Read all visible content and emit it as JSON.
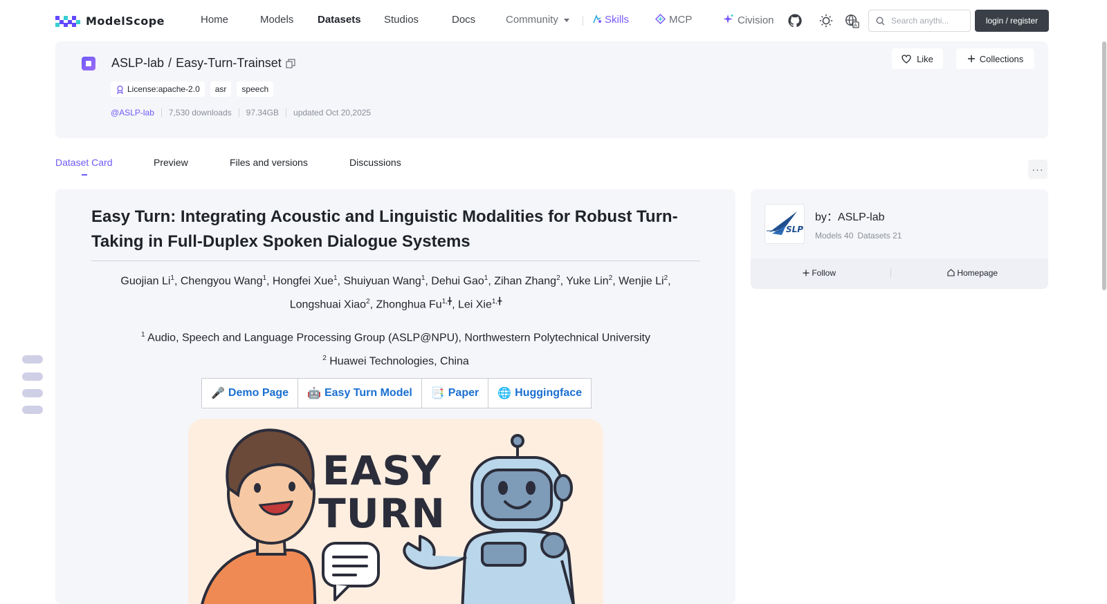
{
  "nav": {
    "logo_text": "ModelScope",
    "items": [
      "Home",
      "Models",
      "Datasets",
      "Studios",
      "Docs"
    ],
    "community": "Community",
    "skills": "Skills",
    "mcp": "MCP",
    "civision": "Civision",
    "search_placeholder": "Search anythi...",
    "login": "login / register"
  },
  "dataset": {
    "owner": "ASLP-lab",
    "sep": "/",
    "name": "Easy-Turn-Trainset",
    "tags": [
      "License:apache-2.0",
      "asr",
      "speech"
    ],
    "owner_handle": "@ASLP-lab",
    "downloads": "7,530 downloads",
    "size": "97.34GB",
    "updated": "updated Oct 20,2025",
    "like": "Like",
    "collections": "Collections"
  },
  "tabs": [
    "Dataset Card",
    "Preview",
    "Files and versions",
    "Discussions"
  ],
  "card": {
    "title": "Easy Turn: Integrating Acoustic and Linguistic Modalities for Robust Turn-Taking in Full-Duplex Spoken Dialogue Systems",
    "authors_line1": [
      {
        "name": "Guojian Li",
        "sup": "1"
      },
      {
        "name": "Chengyou Wang",
        "sup": "1"
      },
      {
        "name": "Hongfei Xue",
        "sup": "1"
      },
      {
        "name": "Shuiyuan Wang",
        "sup": "1"
      },
      {
        "name": "Dehui Gao",
        "sup": "1"
      },
      {
        "name": "Zihan Zhang",
        "sup": "2"
      },
      {
        "name": "Yuke Lin",
        "sup": "2"
      },
      {
        "name": "Wenjie Li",
        "sup": "2"
      }
    ],
    "authors_line2": [
      {
        "name": "Longshuai Xiao",
        "sup": "2"
      },
      {
        "name": "Zhonghua Fu",
        "sup": "1,╋"
      },
      {
        "name": "Lei Xie",
        "sup": "1,╋"
      }
    ],
    "affil1_sup": "1",
    "affil1": "Audio, Speech and Language Processing Group (ASLP@NPU), Northwestern Polytechnical University",
    "affil2_sup": "2",
    "affil2": "Huawei Technologies, China",
    "links": [
      {
        "emoji": "🎤",
        "label": "Demo Page"
      },
      {
        "emoji": "🤖",
        "label": "Easy Turn Model"
      },
      {
        "emoji": "📑",
        "label": "Paper"
      },
      {
        "emoji": "🌐",
        "label": "Huggingface"
      }
    ],
    "hero_text_1": "EASY",
    "hero_text_2": "TURN"
  },
  "sidebar": {
    "by": "by：ASLP-lab",
    "models": "Models 40",
    "datasets": "Datasets 21",
    "follow": "Follow",
    "homepage": "Homepage",
    "logo_text": "SLP"
  },
  "colors": {
    "accent": "#6d5bf7",
    "link": "#1a6fd1",
    "card_bg": "#f5f6fa"
  }
}
